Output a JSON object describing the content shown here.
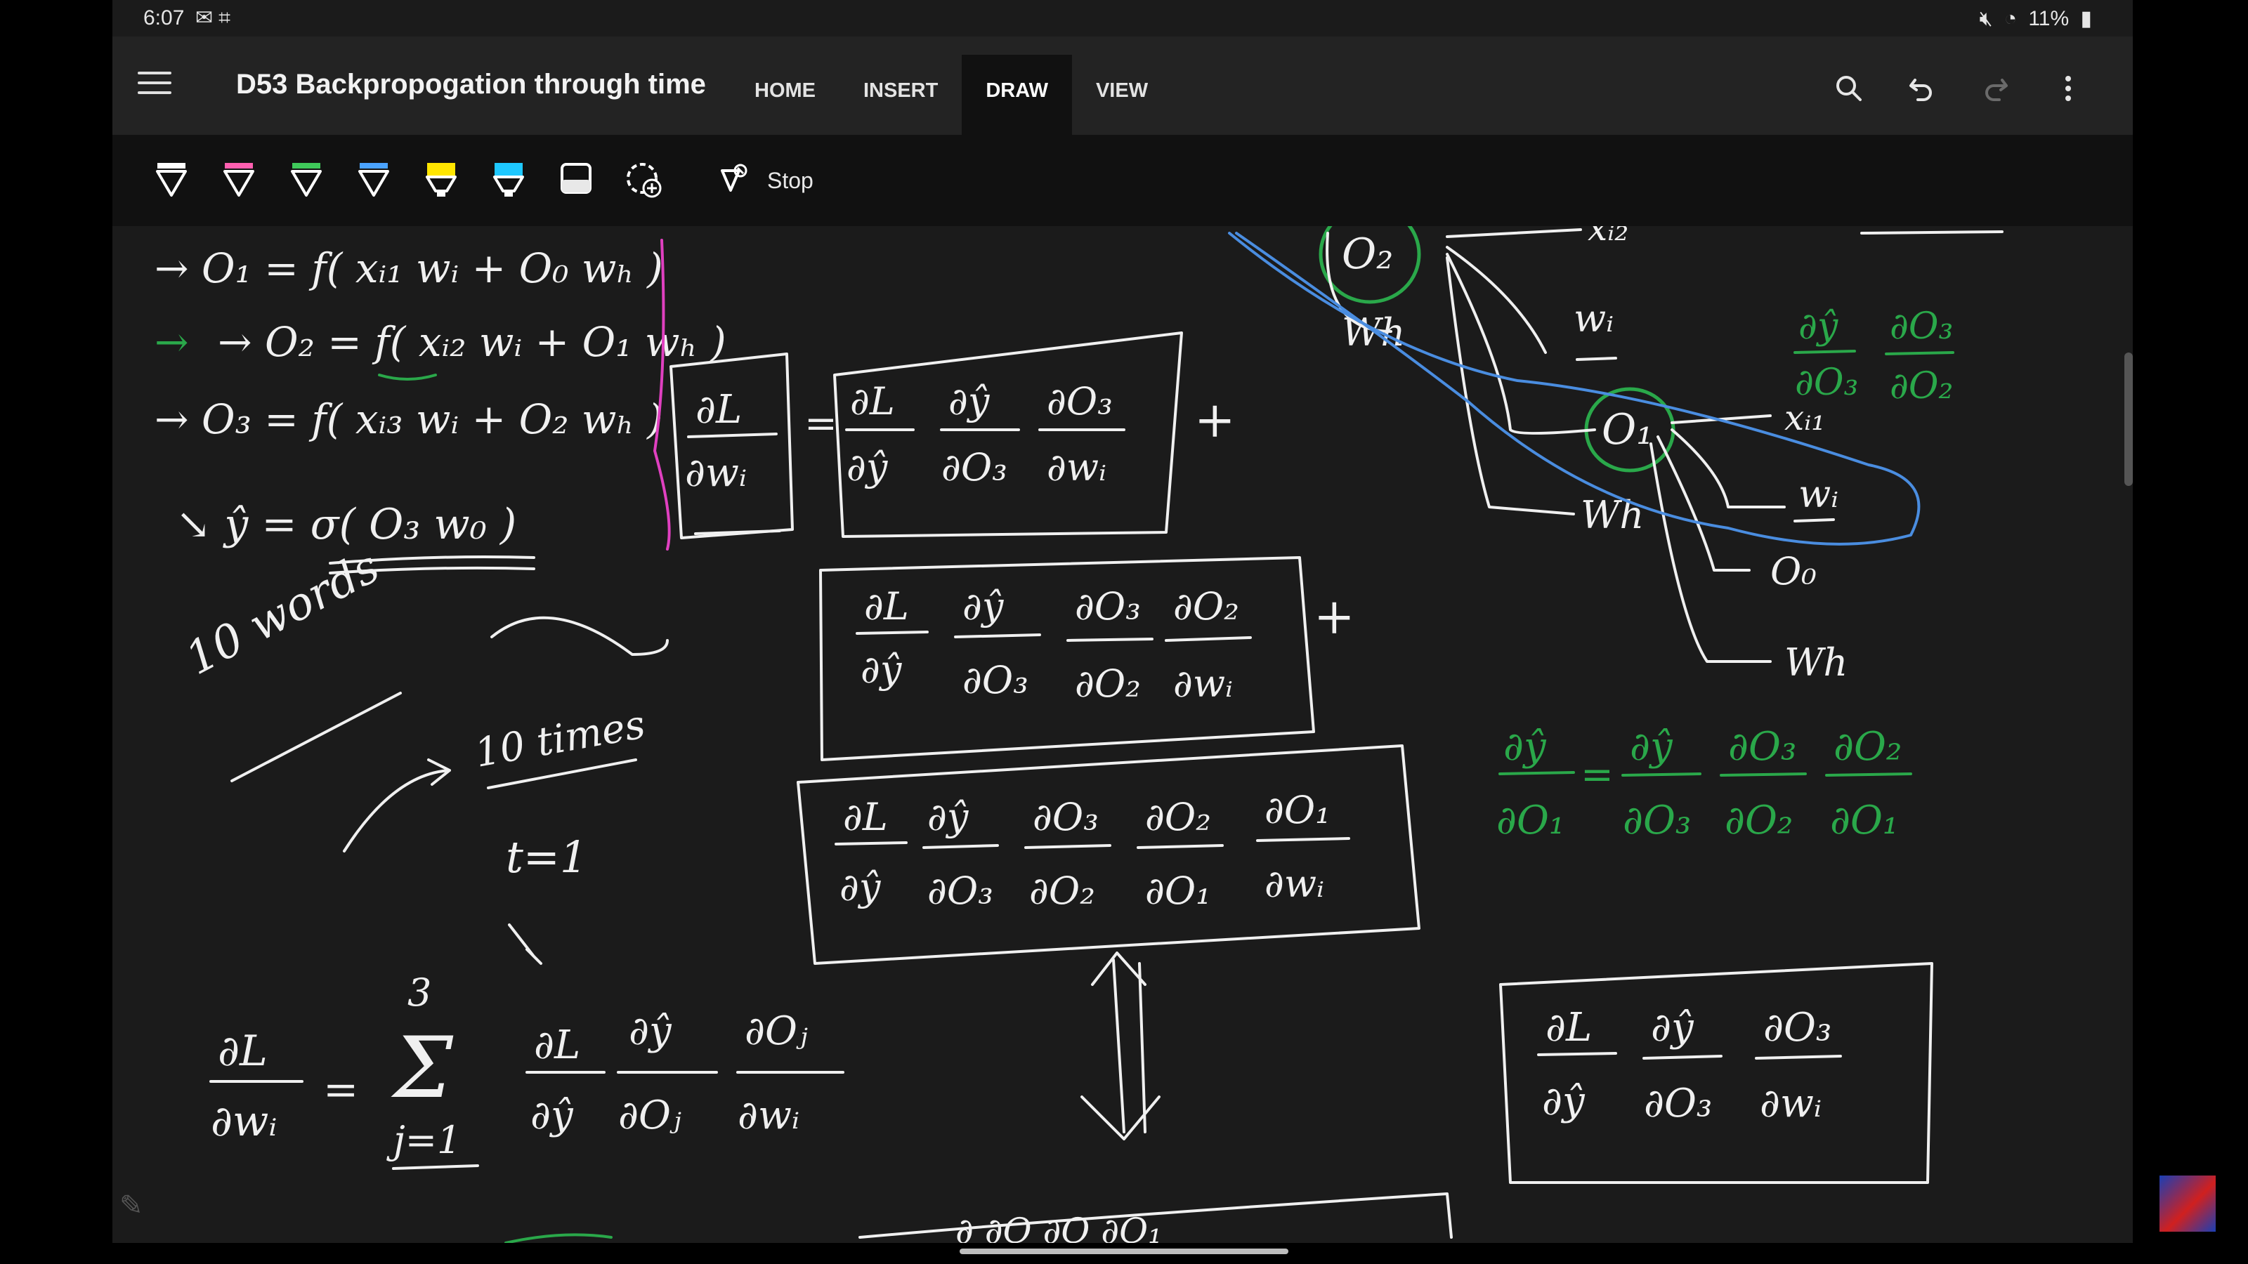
{
  "status_bar": {
    "time": "6:07",
    "battery": "11%",
    "icons_left": [
      "gmail-icon",
      "screenshot-icon"
    ],
    "icons_right": [
      "mute-icon",
      "wifi-icon",
      "battery-icon"
    ]
  },
  "header": {
    "title": "D53 Backpropogation through time",
    "tabs": [
      {
        "label": "HOME",
        "active": false
      },
      {
        "label": "INSERT",
        "active": false
      },
      {
        "label": "DRAW",
        "active": true
      },
      {
        "label": "VIEW",
        "active": false
      }
    ],
    "actions": [
      "search-icon",
      "undo-icon",
      "redo-icon",
      "more-icon"
    ]
  },
  "toolbar": {
    "pens": [
      {
        "name": "pen-white",
        "color": "#ffffff"
      },
      {
        "name": "pen-pink",
        "color": "#ff5fb0"
      },
      {
        "name": "pen-green",
        "color": "#3fc95a"
      },
      {
        "name": "pen-blue",
        "color": "#4aa3ff"
      },
      {
        "name": "highlighter-yellow",
        "color": "#ffe600"
      },
      {
        "name": "highlighter-cyan",
        "color": "#1ec8ff"
      },
      {
        "name": "eraser",
        "color": "#e8e8e8"
      },
      {
        "name": "add-pen",
        "color": "#e8e8e8"
      }
    ],
    "stop_label": "Stop"
  },
  "ink": {
    "eq1": "→ O₁ = f( xᵢ₁ wᵢ + O₀ wₕ )",
    "eq2": "→ O₂ = f( xᵢ₂ wᵢ + O₁ wₕ )",
    "eq3": "→ O₃ = f( xᵢ₃ wᵢ + O₂ wₕ )",
    "eq4": "↘ ŷ = σ( O₃ w₀ )",
    "ten_words": "10 words",
    "ten_times": "10 times",
    "t_eq": "t=1",
    "sum_lhs": "∂L/∂wᵢ",
    "sum_expr": "= Σ j=1..3  ∂L/∂ŷ · ∂ŷ/∂Oⱼ · ∂Oⱼ/∂wᵢ",
    "box1": "∂L/∂wᵢ = ∂L/∂ŷ · ∂ŷ/∂O₃ · ∂O₃/∂wᵢ +",
    "box2": "∂L/∂ŷ · ∂ŷ/∂O₃ · ∂O₃/∂O₂ · ∂O₂/∂wᵢ +",
    "box3": "∂L/∂ŷ · ∂ŷ/∂O₃ · ∂O₃/∂O₂ · ∂O₂/∂O₁ · ∂O₁/∂wᵢ",
    "box4": "∂L/∂ŷ · ∂ŷ/∂O₃ · ∂O₃/∂wᵢ",
    "green_top": "∂ŷ/∂O₃ · ∂O₃/∂O₂",
    "green_eq": "∂ŷ/∂O₁ = ∂ŷ/∂O₃ · ∂O₃/∂O₂ · ∂O₂/∂O₁",
    "tree_nodes": [
      "O₂",
      "Wh",
      "xᵢ₂",
      "wᵢ",
      "O₁",
      "xᵢ₁",
      "wᵢ",
      "Wh",
      "O₀",
      "Wh"
    ]
  }
}
